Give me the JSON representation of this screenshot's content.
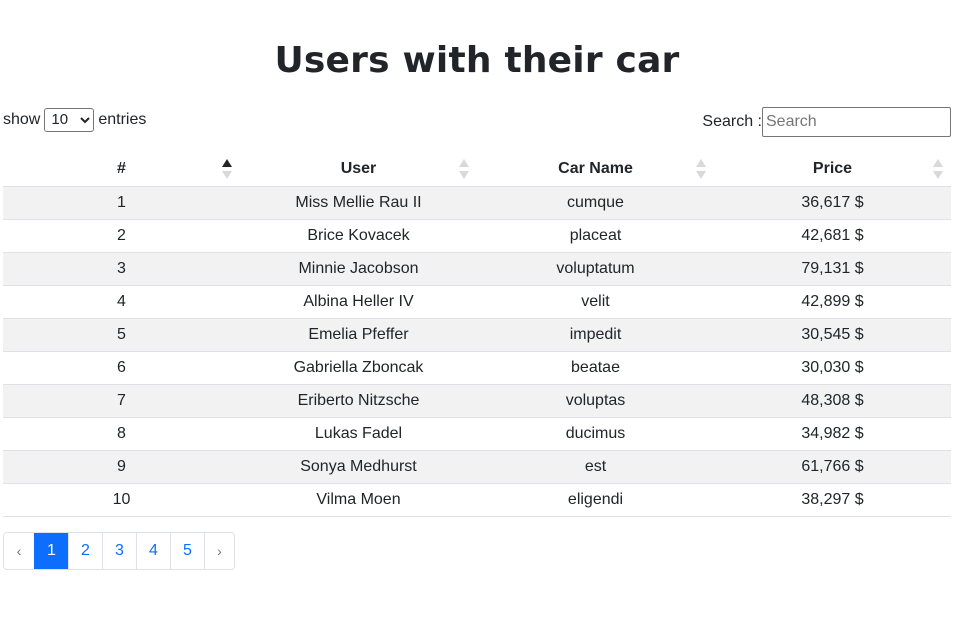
{
  "page": {
    "title": "Users with their car"
  },
  "controls": {
    "length_prefix": "show",
    "length_selected": "10",
    "length_suffix": "entries",
    "search_label": "Search :",
    "search_placeholder": "Search",
    "search_value": ""
  },
  "table": {
    "columns": [
      "#",
      "User",
      "Car Name",
      "Price"
    ],
    "rows": [
      [
        "1",
        "Miss Mellie Rau II",
        "cumque",
        "36,617 $"
      ],
      [
        "2",
        "Brice Kovacek",
        "placeat",
        "42,681 $"
      ],
      [
        "3",
        "Minnie Jacobson",
        "voluptatum",
        "79,131 $"
      ],
      [
        "4",
        "Albina Heller IV",
        "velit",
        "42,899 $"
      ],
      [
        "5",
        "Emelia Pfeffer",
        "impedit",
        "30,545 $"
      ],
      [
        "6",
        "Gabriella Zboncak",
        "beatae",
        "30,030 $"
      ],
      [
        "7",
        "Eriberto Nitzsche",
        "voluptas",
        "48,308 $"
      ],
      [
        "8",
        "Lukas Fadel",
        "ducimus",
        "34,982 $"
      ],
      [
        "9",
        "Sonya Medhurst",
        "est",
        "61,766 $"
      ],
      [
        "10",
        "Vilma Moen",
        "eligendi",
        "38,297 $"
      ]
    ]
  },
  "pagination": {
    "prev": "‹",
    "next": "›",
    "pages": [
      "1",
      "2",
      "3",
      "4",
      "5"
    ],
    "active": "1"
  },
  "colors": {
    "accent": "#0d6efd",
    "stripe": "#f2f2f2",
    "text": "#212529"
  }
}
